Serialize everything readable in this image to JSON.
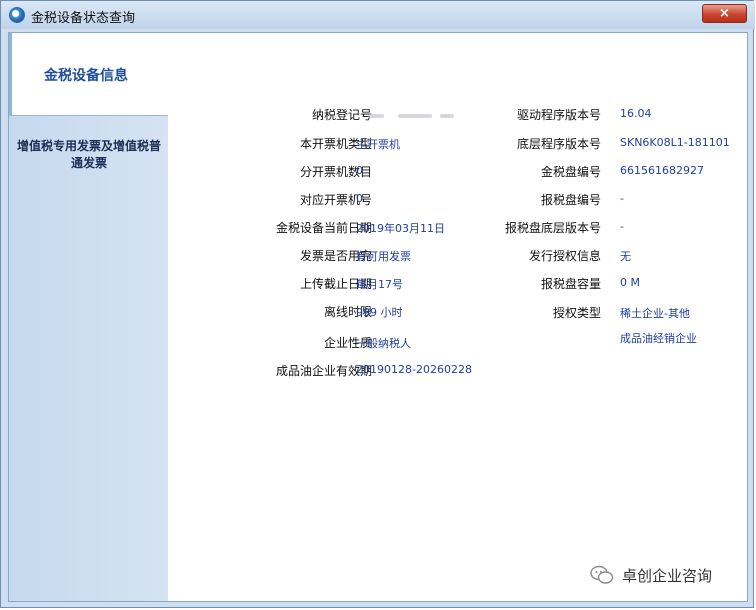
{
  "window": {
    "title": "金税设备状态查询",
    "close_label": "×"
  },
  "tabs": {
    "active": "金税设备信息",
    "inactive": "增值税专用发票及增值税普通发票"
  },
  "left_fields": [
    {
      "label": "纳税登记号",
      "value": ""
    },
    {
      "label": "本开票机类型",
      "value": "主开票机"
    },
    {
      "label": "分开票机数目",
      "value": "0"
    },
    {
      "label": "对应开票机号",
      "value": "0"
    },
    {
      "label": "金税设备当前日期",
      "value": "2019年03月11日"
    },
    {
      "label": "发票是否用完",
      "value": "有可用发票"
    },
    {
      "label": "上传截止日期",
      "value": "每月17号"
    },
    {
      "label": "离线时限",
      "value": "999 小时"
    },
    {
      "label": "企业性质",
      "value": "一般纳税人"
    },
    {
      "label": "成品油企业有效期",
      "value": "20190128-20260228"
    }
  ],
  "right_fields": [
    {
      "label": "驱动程序版本号",
      "value": "16.04"
    },
    {
      "label": "底层程序版本号",
      "value": "SKN6K08L1-181101"
    },
    {
      "label": "金税盘编号",
      "value": "661561682927"
    },
    {
      "label": "报税盘编号",
      "value": "-"
    },
    {
      "label": "报税盘底层版本号",
      "value": "-"
    },
    {
      "label": "发行授权信息",
      "value": "无"
    },
    {
      "label": "报税盘容量",
      "value": "0 M"
    },
    {
      "label": "授权类型",
      "value": "稀土企业-其他"
    },
    {
      "label": "",
      "value": "成品油经销企业"
    }
  ],
  "watermark": {
    "text": "卓创企业咨询",
    "icon": "wechat-icon"
  },
  "colors": {
    "value_text": "#1f3f9e",
    "titlebar": "#cfdff0",
    "active_tab_text": "#1f4f9a",
    "close_button": "#c9452f"
  }
}
